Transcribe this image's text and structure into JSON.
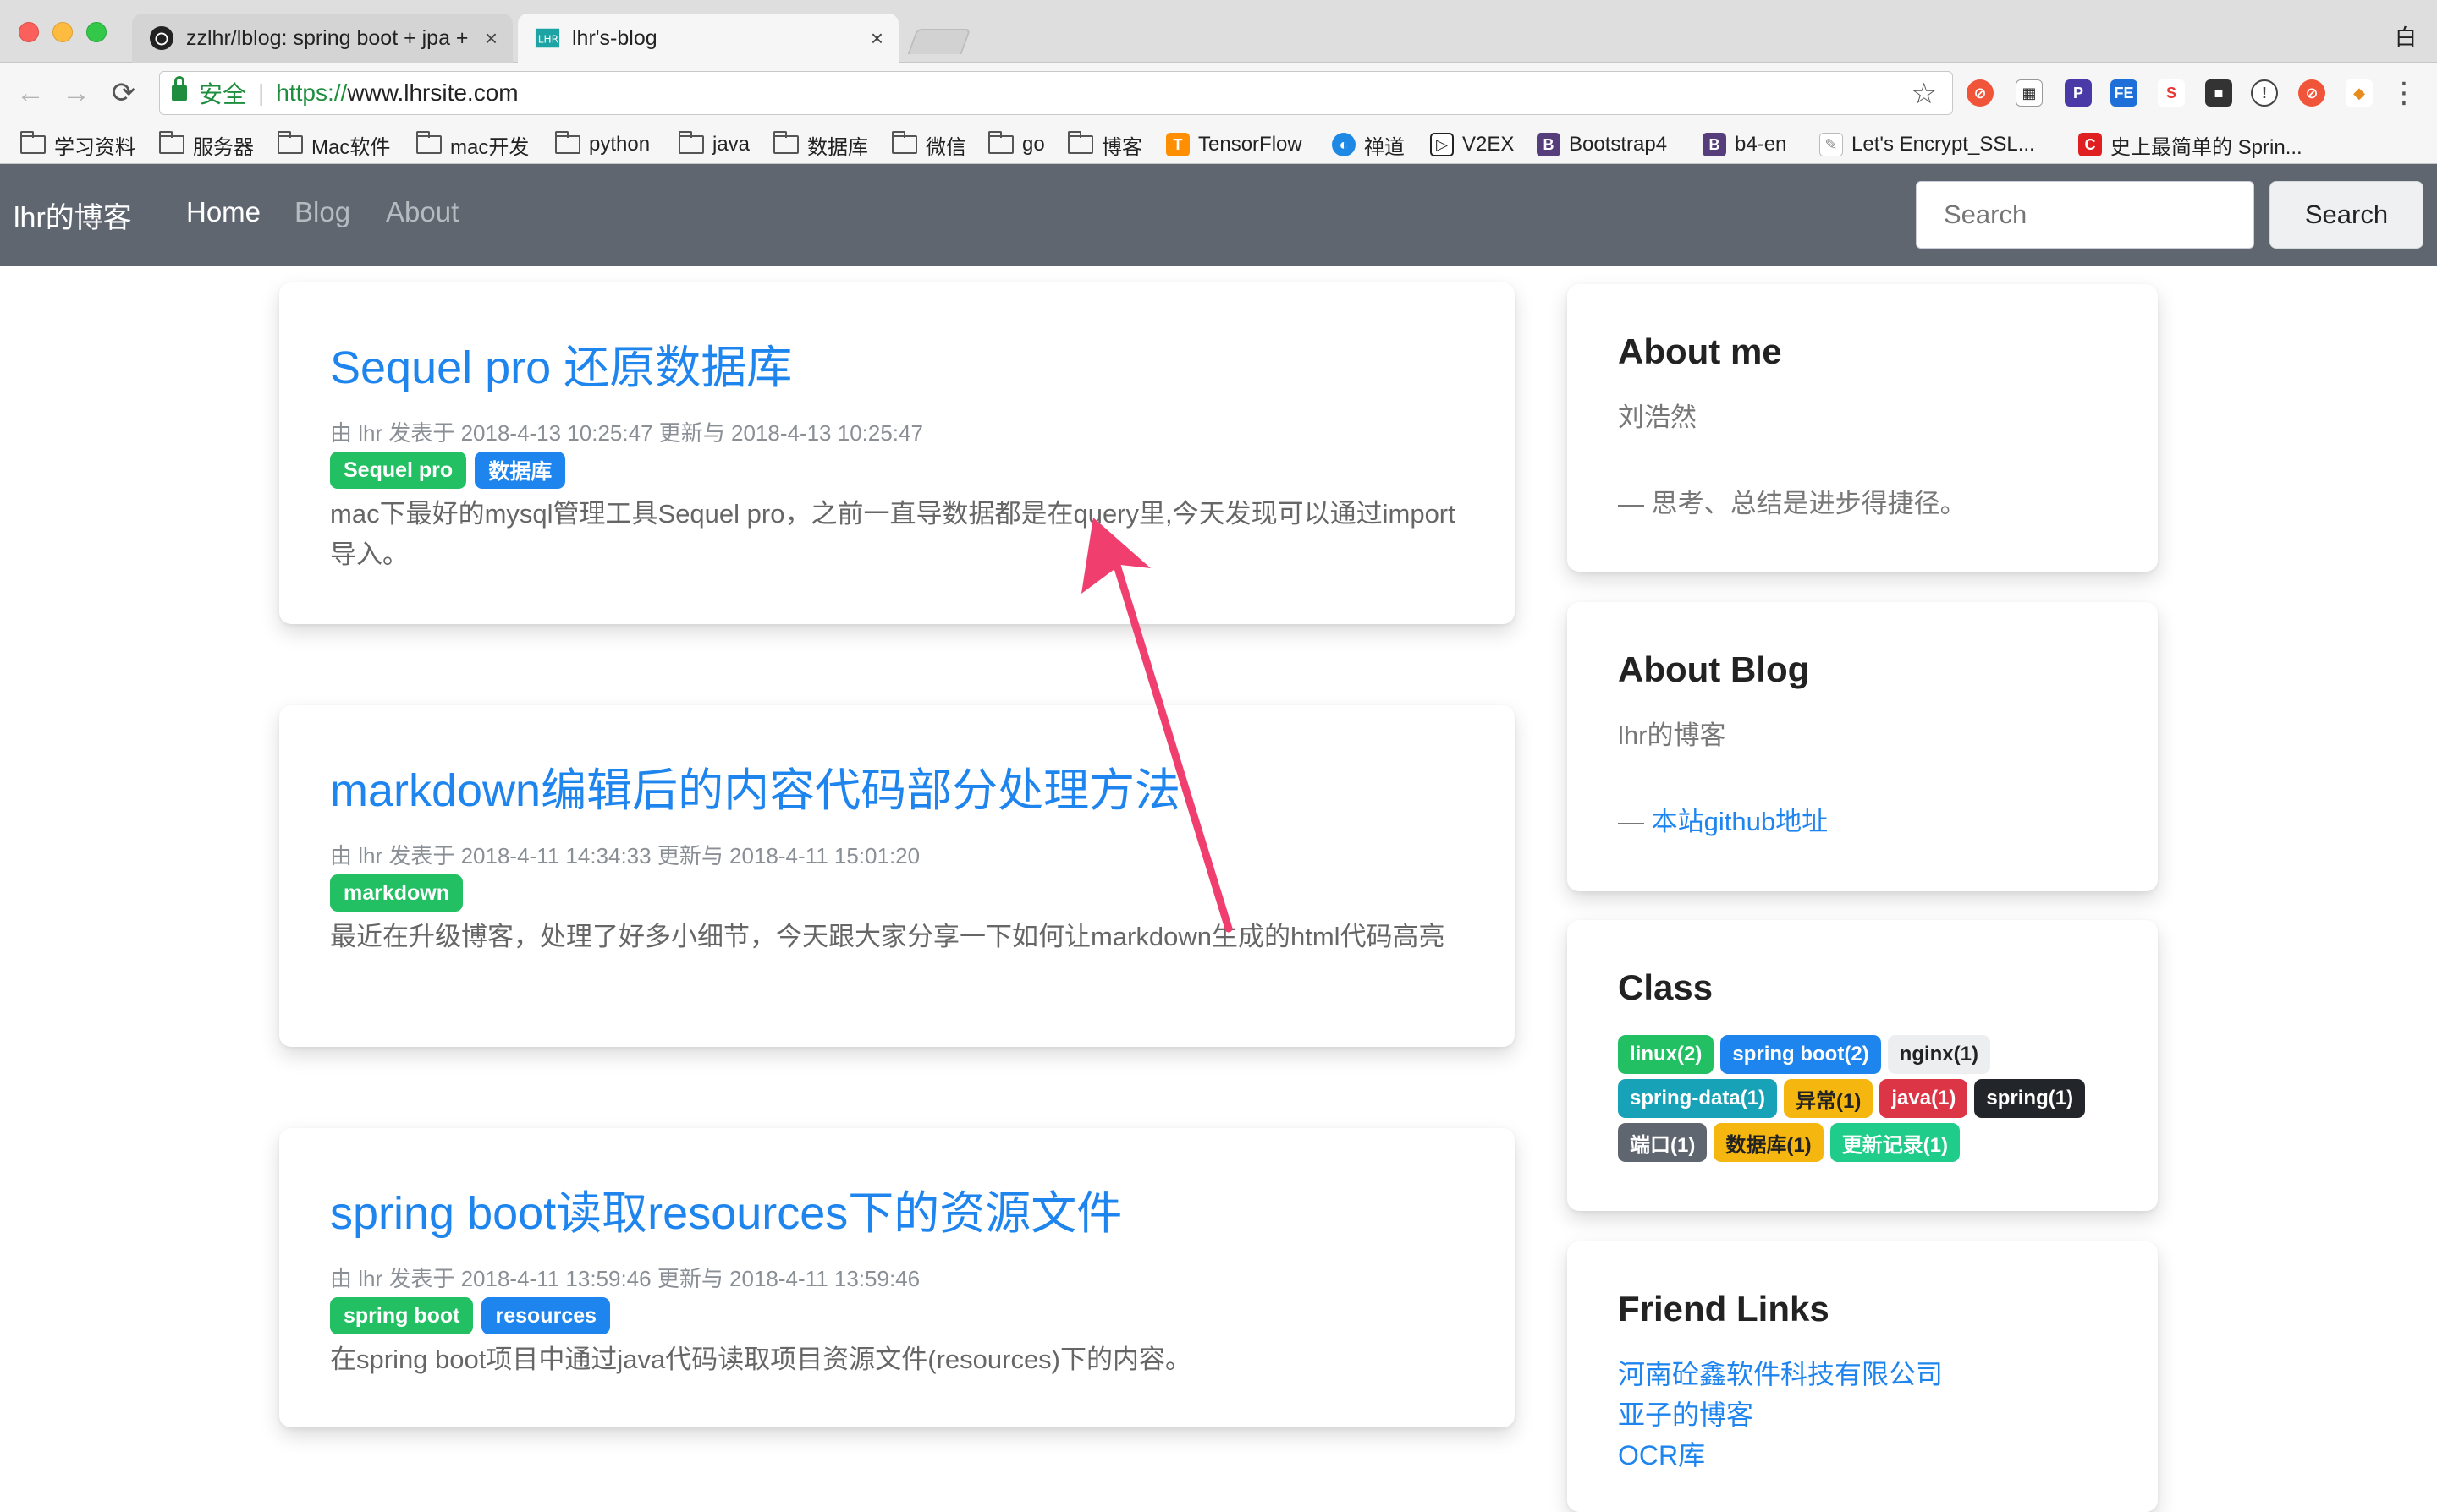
{
  "browser": {
    "tabs": [
      {
        "label": "zzlhr/lblog: spring boot + jpa + ",
        "close": "×"
      },
      {
        "label": "lhr's-blog",
        "close": "×"
      }
    ],
    "user_label": "白",
    "secure_label": "安全",
    "url_scheme": "https://",
    "url_host": "www.lhrsite.com",
    "bookmarks": [
      "学习资料",
      "服务器",
      "Mac软件",
      "mac开发",
      "python",
      "java",
      "数据库",
      "微信",
      "go",
      "博客",
      "TensorFlow",
      "禅道",
      "V2EX",
      "Bootstrap4",
      "b4-en",
      "Let's Encrypt_SSL...",
      "史上最简单的 Sprin..."
    ]
  },
  "site": {
    "brand": "lhr的博客",
    "nav": [
      "Home",
      "Blog",
      "About"
    ],
    "search_placeholder": "Search",
    "search_button": "Search"
  },
  "posts": [
    {
      "title": "Sequel pro 还原数据库",
      "meta": "由 lhr 发表于 2018-4-13 10:25:47 更新与 2018-4-13 10:25:47",
      "tags": [
        "Sequel pro",
        "数据库"
      ],
      "excerpt": "mac下最好的mysql管理工具Sequel pro，之前一直导数据都是在query里,今天发现可以通过import导入。"
    },
    {
      "title": "markdown编辑后的内容代码部分处理方法",
      "meta": "由 lhr 发表于 2018-4-11 14:34:33 更新与 2018-4-11 15:01:20",
      "tags": [
        "markdown"
      ],
      "excerpt": "最近在升级博客，处理了好多小细节，今天跟大家分享一下如何让markdown生成的html代码高亮"
    },
    {
      "title": "spring boot读取resources下的资源文件",
      "meta": "由 lhr 发表于 2018-4-11 13:59:46 更新与 2018-4-11 13:59:46",
      "tags": [
        "spring boot",
        "resources"
      ],
      "excerpt": "在spring boot项目中通过java代码读取项目资源文件(resources)下的内容。"
    }
  ],
  "sidebar": {
    "about_me": {
      "title": "About me",
      "name": "刘浩然",
      "motto": "— 思考、总结是进步得捷径。"
    },
    "about_blog": {
      "title": "About Blog",
      "name": "lhr的博客",
      "link_prefix": "— ",
      "link": "本站github地址"
    },
    "class": {
      "title": "Class",
      "rows": [
        [
          "linux(2)",
          "spring boot(2)",
          "nginx(1)"
        ],
        [
          "spring-data(1)",
          "异常(1)",
          "java(1)",
          "spring(1)"
        ],
        [
          "端口(1)",
          "数据库(1)",
          "更新记录(1)"
        ]
      ]
    },
    "friend_links": {
      "title": "Friend Links",
      "links": [
        "河南砼鑫软件科技有限公司",
        "亚子的博客",
        "OCR库"
      ]
    }
  },
  "colors": {
    "link_blue": "#1e84ee",
    "tag_green": "#22c063",
    "navbar": "#5f6670",
    "annotation_arrow": "#f03e6e"
  }
}
